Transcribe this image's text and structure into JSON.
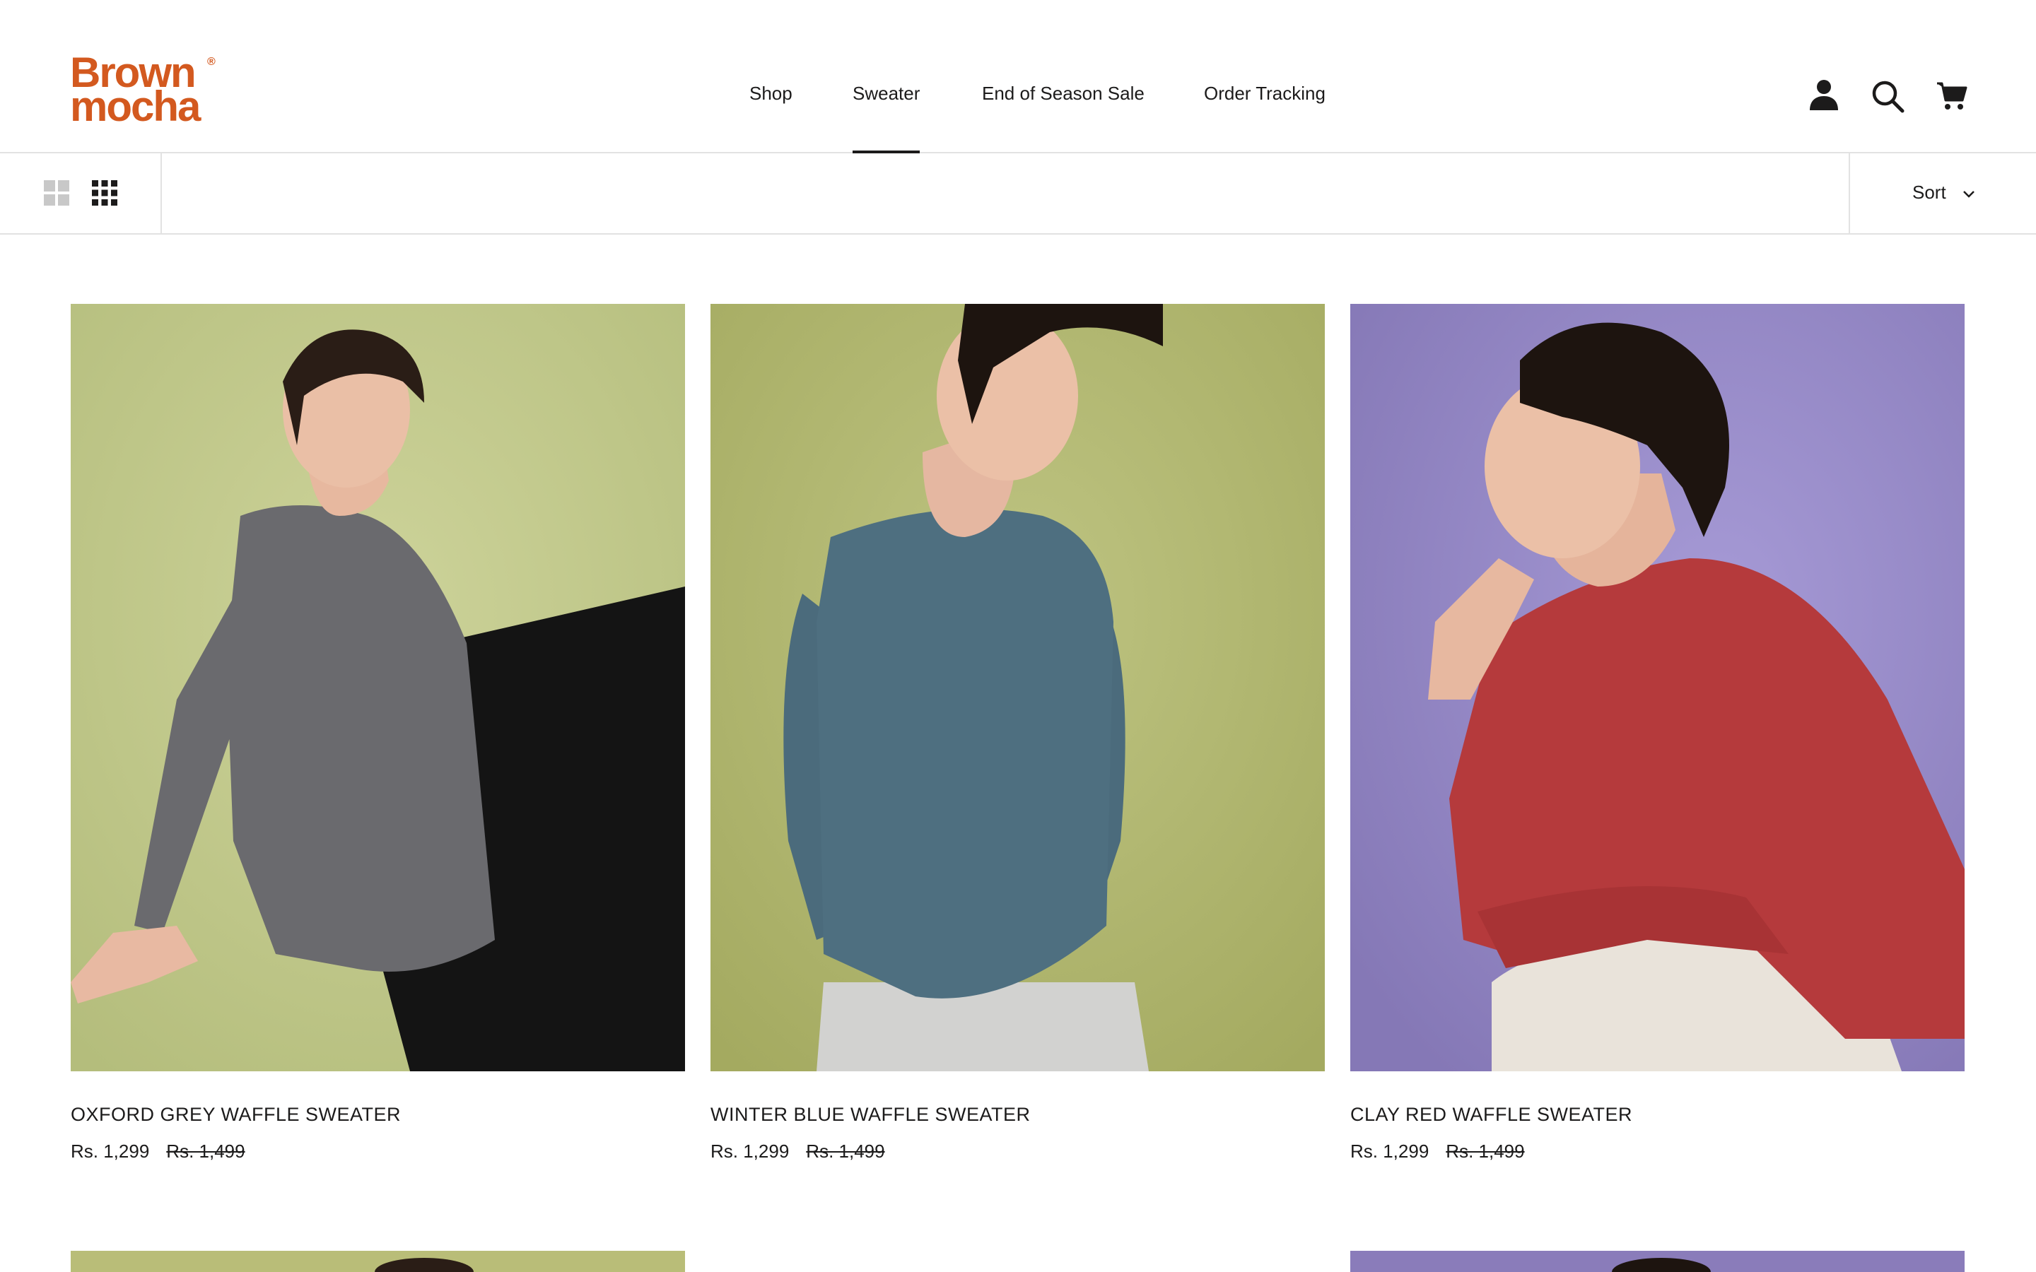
{
  "brand": {
    "line1": "Brown",
    "line2": "mocha",
    "reg": "®",
    "color": "#d3591f"
  },
  "nav": {
    "items": [
      {
        "label": "Shop"
      },
      {
        "label": "Sweater",
        "active": true
      },
      {
        "label": "End of Season Sale"
      },
      {
        "label": "Order Tracking"
      }
    ]
  },
  "header_icons": [
    "account-icon",
    "search-icon",
    "cart-icon"
  ],
  "toolbar": {
    "layout_options": [
      "grid-2-icon",
      "grid-3-icon"
    ],
    "selected_layout": "grid-3-icon",
    "sort_label": "Sort"
  },
  "products": [
    {
      "title": "OXFORD GREY WAFFLE SWEATER",
      "price": "Rs. 1,299",
      "compare_price": "Rs. 1,499",
      "background": "#c4cc8e",
      "sweater_color": "#6a6a6e"
    },
    {
      "title": "WINTER BLUE WAFFLE SWEATER",
      "price": "Rs. 1,299",
      "compare_price": "Rs. 1,499",
      "background": "#b2b670",
      "sweater_color": "#4e6f80"
    },
    {
      "title": "CLAY RED WAFFLE SWEATER",
      "price": "Rs. 1,299",
      "compare_price": "Rs. 1,499",
      "background": "#9589c4",
      "sweater_color": "#b53a3c"
    }
  ]
}
